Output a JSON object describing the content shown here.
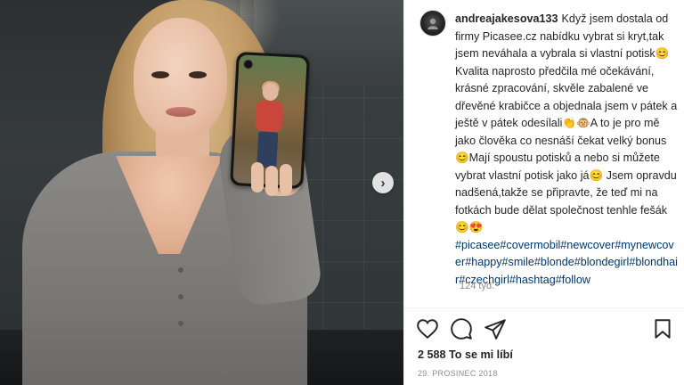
{
  "post": {
    "username": "andreajakesova133",
    "caption": "Když jsem dostala od firmy Picasee.cz nabídku vybrat si kryt,tak jsem neváhala a vybrala si vlastní potisk😊 Kvalita naprosto předčila mé očekávání, krásné zpracování, skvěle zabalené ve dřevěné krabičce a objednala jsem v pátek a ještě v pátek odesílali👏🐵A to je pro mě jako člověka co nesnáší čekat velký bonus😊Mají spoustu potisků a nebo si můžete vybrat vlastní potisk jako já😊 Jsem opravdu nadšená,takže se připravte, že teď mi na fotkách bude dělat společnost tenhle fešák😊😍",
    "hashtags": "#picasee#covermobil#newcover#mynewcover#happy#smile#blonde#blondegirl#blondhair#czechgirl#hashtag#follow",
    "time_ago": "124 týd.",
    "likes": "2 588 To se mi líbí",
    "date": "29. PROSINEC 2018"
  },
  "icons": {
    "like": "heart-icon",
    "comment": "comment-icon",
    "share": "paper-plane-icon",
    "save": "bookmark-icon",
    "next": "chevron-right-icon"
  },
  "carousel": {
    "next_glyph": "›"
  },
  "colors": {
    "text": "#262626",
    "muted": "#8e8e8e",
    "hashtag": "#00376b",
    "divider": "#efefef"
  }
}
